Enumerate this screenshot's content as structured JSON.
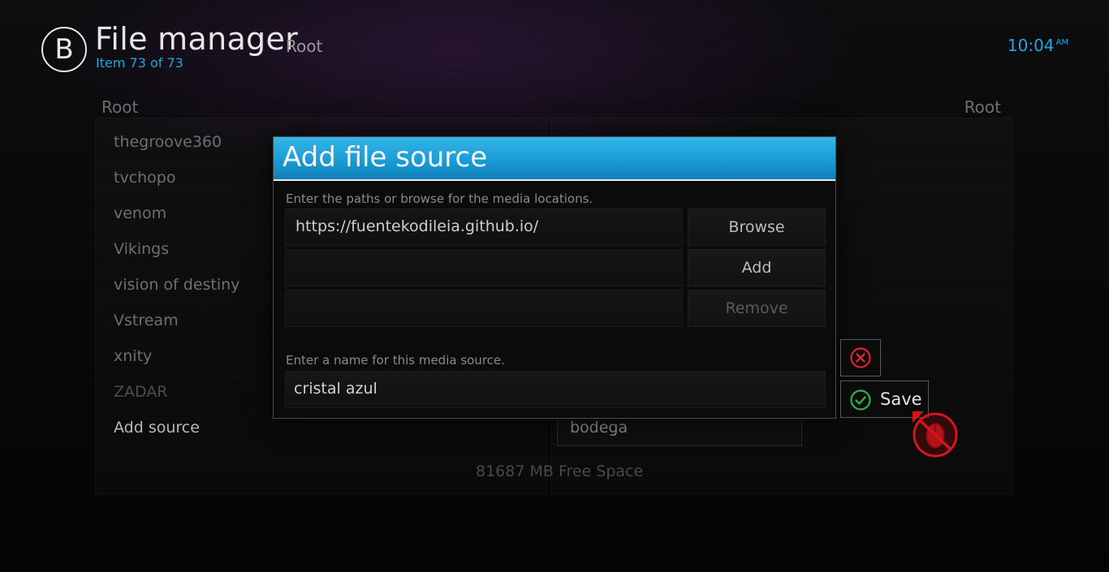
{
  "header": {
    "logo_letter": "B",
    "title": "File manager",
    "subtitle": "Root",
    "item_count": "Item 73 of 73",
    "clock_time": "10:04",
    "clock_ampm": "AM"
  },
  "left_pane": {
    "heading": "Root",
    "items": [
      "thegroove360",
      "tvchopo",
      "venom",
      "Vikings",
      "vision of destiny",
      "Vstream",
      "xnity",
      "ZADAR",
      "Add source"
    ]
  },
  "right_pane": {
    "heading": "Root",
    "selected_item": "bodega",
    "free_space": "81687 MB Free Space"
  },
  "dialog": {
    "title": "Add file source",
    "paths_label": "Enter the paths or browse for the media locations.",
    "path_value": "https://fuentekodileia.github.io/",
    "browse_label": "Browse",
    "add_label": "Add",
    "remove_label": "Remove",
    "name_label": "Enter a name for this media source.",
    "name_value": "cristal azul",
    "save_label": "Save"
  },
  "colors": {
    "accent": "#1ea6dc",
    "dialog_title_bg": "#1a9cd6",
    "cancel_icon": "#e0242a",
    "save_icon": "#2bb24c",
    "no_mouse_badge": "#d4161c"
  },
  "icons": {
    "cancel": "close-circle-icon",
    "save": "check-circle-icon",
    "mouse_disabled": "mouse-disabled-icon"
  }
}
